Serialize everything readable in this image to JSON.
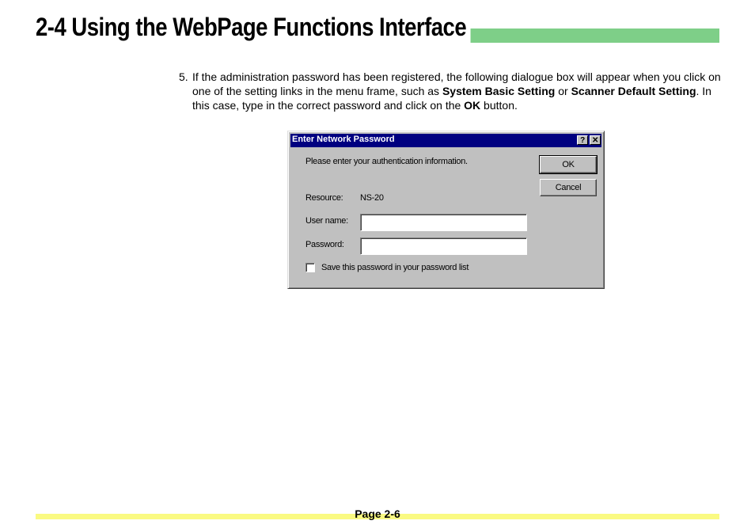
{
  "heading": "2-4  Using the WebPage Functions Interface",
  "step": {
    "number": "5.",
    "text_1": "If the administration password has been registered, the following dialogue box will appear when you click on one of the setting links in the menu frame, such as ",
    "bold_1": "System Basic Setting",
    "text_2": " or ",
    "bold_2": "Scanner Default Setting",
    "text_3": ". In this case, type in the correct password and click on the ",
    "bold_3": "OK",
    "text_4": " button."
  },
  "dialog": {
    "title": "Enter Network Password",
    "help_symbol": "?",
    "close_symbol": "✕",
    "prompt": "Please enter your authentication information.",
    "resource_label": "Resource:",
    "resource_value": "NS-20",
    "username_label": "User name:",
    "username_value": "",
    "password_label": "Password:",
    "password_value": "",
    "save_checkbox_label": "Save this password in your password list",
    "save_checked": false,
    "ok_label": "OK",
    "cancel_label": "Cancel"
  },
  "footer": {
    "page": "Page 2-6"
  },
  "colors": {
    "heading_bar": "#7ecf88",
    "footer_bar": "#fafa82",
    "dialog_titlebar": "#000080"
  }
}
